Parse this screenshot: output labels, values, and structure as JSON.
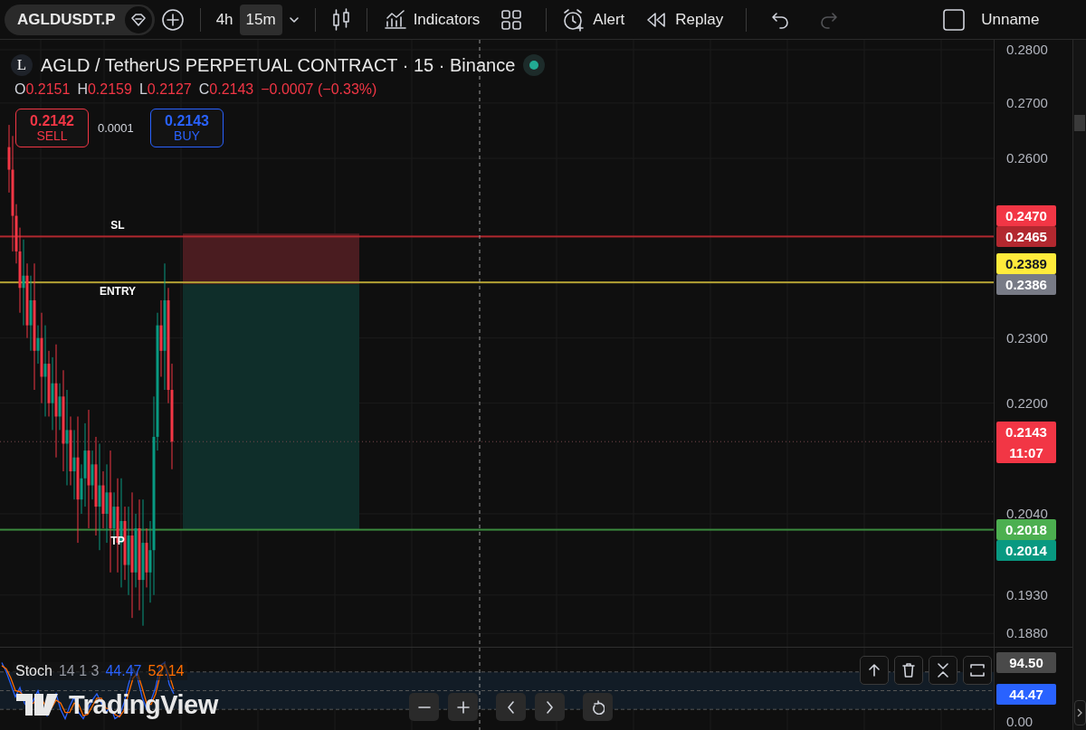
{
  "toolbar": {
    "symbol": "AGLDUSDT.P",
    "timeframes": [
      {
        "label": "4h",
        "selected": false
      },
      {
        "label": "15m",
        "selected": true
      }
    ],
    "buttons": [
      {
        "kind": "indicators",
        "label": "Indicators"
      },
      {
        "kind": "layouts"
      },
      {
        "kind": "alert",
        "label": "Alert"
      },
      {
        "kind": "replay",
        "label": "Replay"
      }
    ],
    "history": [
      {
        "kind": "undo",
        "disabled": false
      },
      {
        "kind": "redo",
        "disabled": true
      }
    ],
    "layout_name": "Unname"
  },
  "legend": {
    "logo": "L",
    "title": "AGLD / TetherUS PERPETUAL CONTRACT · 15 · Binance",
    "ohlc": [
      {
        "label": "O",
        "value": "0.2151"
      },
      {
        "label": "H",
        "value": "0.2159"
      },
      {
        "label": "L",
        "value": "0.2127"
      },
      {
        "label": "C",
        "value": "0.2143"
      }
    ],
    "change": "−0.0007 (−0.33%)"
  },
  "trade": {
    "sell": {
      "price": "0.2142",
      "label": "SELL"
    },
    "spread": "0.0001",
    "buy": {
      "price": "0.2143",
      "label": "BUY"
    }
  },
  "drawings": [
    {
      "kind": "stop",
      "label": "SL"
    },
    {
      "kind": "entry",
      "label": "ENTRY"
    },
    {
      "kind": "target",
      "label": "TP"
    }
  ],
  "price_axis": {
    "labels": [
      "0.2800",
      "0.2700",
      "0.2600",
      "0.2300",
      "0.2200",
      "0.2040",
      "0.1930",
      "0.1880"
    ],
    "tags": [
      {
        "text": "0.2470",
        "color": "#f23645"
      },
      {
        "text": "0.2465",
        "color": "#b2282f"
      },
      {
        "text": "0.2389",
        "color": "#ffeb3b"
      },
      {
        "text": "0.2386",
        "color": "#787b86"
      },
      {
        "text": "0.2143",
        "sub": "11:07",
        "color": "#f23645"
      },
      {
        "text": "0.2018",
        "color": "#4caf50"
      },
      {
        "text": "0.2014",
        "color": "#089981"
      }
    ]
  },
  "stoch": {
    "name": "Stoch",
    "params": "14 1 3",
    "values": [
      {
        "text": "44.47",
        "color": "#2962ff"
      },
      {
        "text": "52.14",
        "color": "#ff6d00"
      }
    ],
    "axis_tags": [
      {
        "text": "94.50",
        "color": "#4a4a4a"
      },
      {
        "text": "44.47",
        "color": "#2962ff"
      }
    ],
    "axis_labels": [
      "0.00"
    ]
  },
  "branding": "TradingView",
  "pane_controls": [
    {
      "kind": "up"
    },
    {
      "kind": "delete"
    },
    {
      "kind": "collapse"
    },
    {
      "kind": "maximize"
    }
  ],
  "chart_controls": [
    {
      "kind": "zoom-out"
    },
    {
      "kind": "zoom-in"
    },
    {
      "kind": "left"
    },
    {
      "kind": "right"
    },
    {
      "kind": "reset"
    }
  ]
}
